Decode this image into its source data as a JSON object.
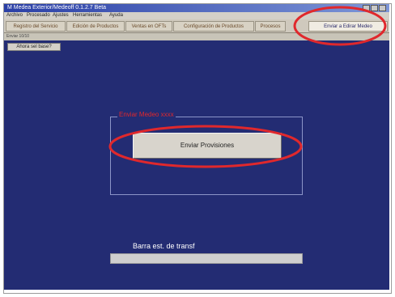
{
  "window": {
    "title": "M Medea Exterior/Medeoff 0.1.2.7 Beta"
  },
  "menu": [
    "Archivo",
    "Procesado",
    "Ajustes",
    "Herramientas",
    "Ayuda"
  ],
  "tabs": [
    {
      "label": "Registro del Servicio"
    },
    {
      "label": "Edición de Productos"
    },
    {
      "label": "Ventas en OFTs"
    },
    {
      "label": "Configuración de Productos"
    },
    {
      "label": "Procesos"
    },
    {
      "label": "Enviar a Edirar Medeo"
    }
  ],
  "subbar": {
    "text": "Enviar 10/10"
  },
  "toolbar": {
    "small_button": "Ahora sel base?"
  },
  "group": {
    "label": "Enviar Medeo xxxx"
  },
  "main_button": {
    "label": "Enviar Provisiones"
  },
  "status": {
    "caption": "Barra est. de transf",
    "progress": 0
  },
  "colors": {
    "background": "#232c73",
    "annotation": "#e0282c"
  }
}
